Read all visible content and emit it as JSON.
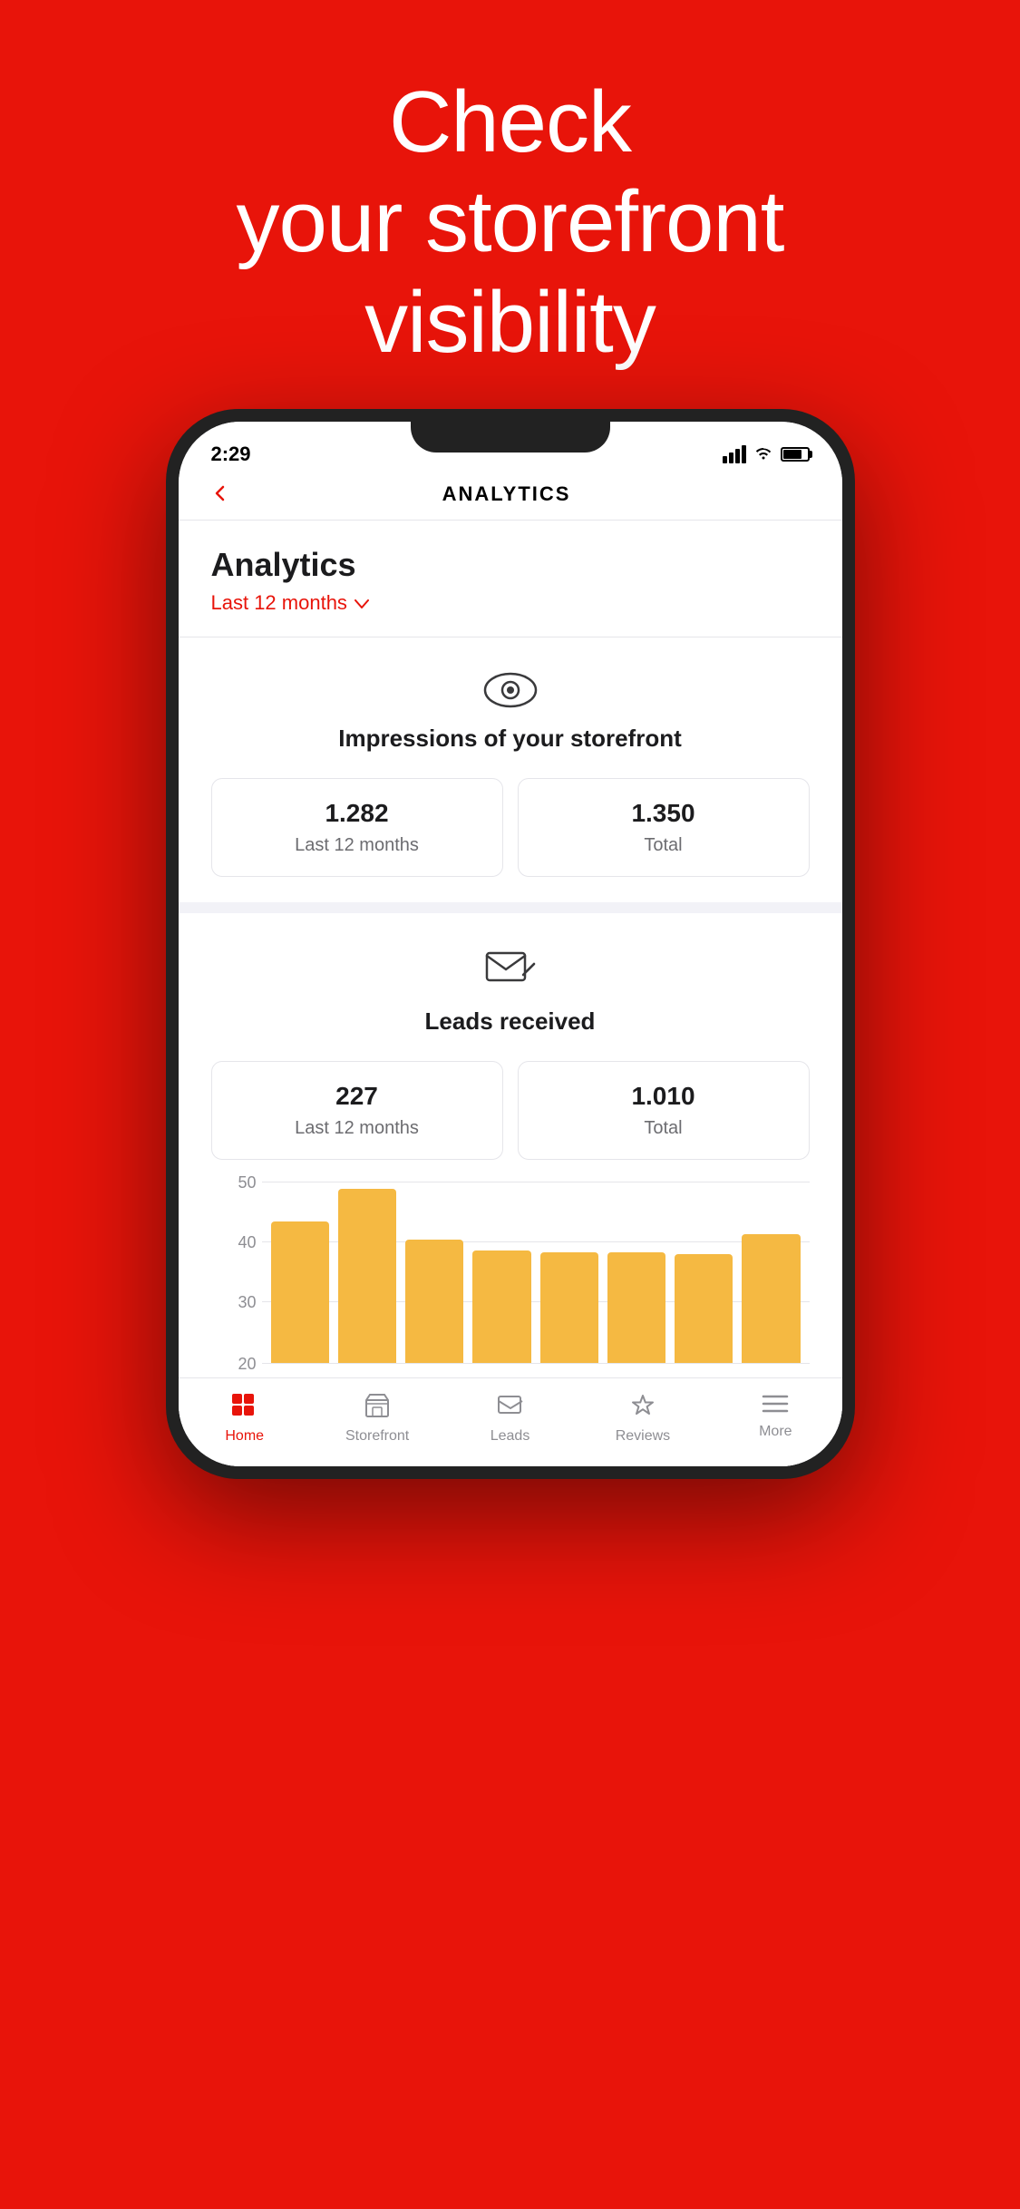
{
  "hero": {
    "line1": "Check",
    "line2": "your storefront",
    "line3": "visibility"
  },
  "status_bar": {
    "time": "2:29"
  },
  "nav": {
    "title": "ANALYTICS",
    "back_label": "←"
  },
  "page": {
    "title": "Analytics",
    "date_filter": "Last 12 months"
  },
  "impressions": {
    "section_title": "Impressions of your storefront",
    "stat1_number": "1.282",
    "stat1_label": "Last 12 months",
    "stat2_number": "1.350",
    "stat2_label": "Total"
  },
  "leads": {
    "section_title": "Leads received",
    "stat1_number": "227",
    "stat1_label": "Last 12 months",
    "stat2_number": "1.010",
    "stat2_label": "Total"
  },
  "chart": {
    "y_labels": [
      "50",
      "40",
      "30",
      "20"
    ],
    "bars": [
      {
        "height_pct": 78
      },
      {
        "height_pct": 96
      },
      {
        "height_pct": 68
      },
      {
        "height_pct": 62
      },
      {
        "height_pct": 61
      },
      {
        "height_pct": 61
      },
      {
        "height_pct": 60
      },
      {
        "height_pct": 71
      }
    ]
  },
  "tabs": [
    {
      "label": "Home",
      "active": true
    },
    {
      "label": "Storefront",
      "active": false
    },
    {
      "label": "Leads",
      "active": false
    },
    {
      "label": "Reviews",
      "active": false
    },
    {
      "label": "More",
      "active": false
    }
  ]
}
